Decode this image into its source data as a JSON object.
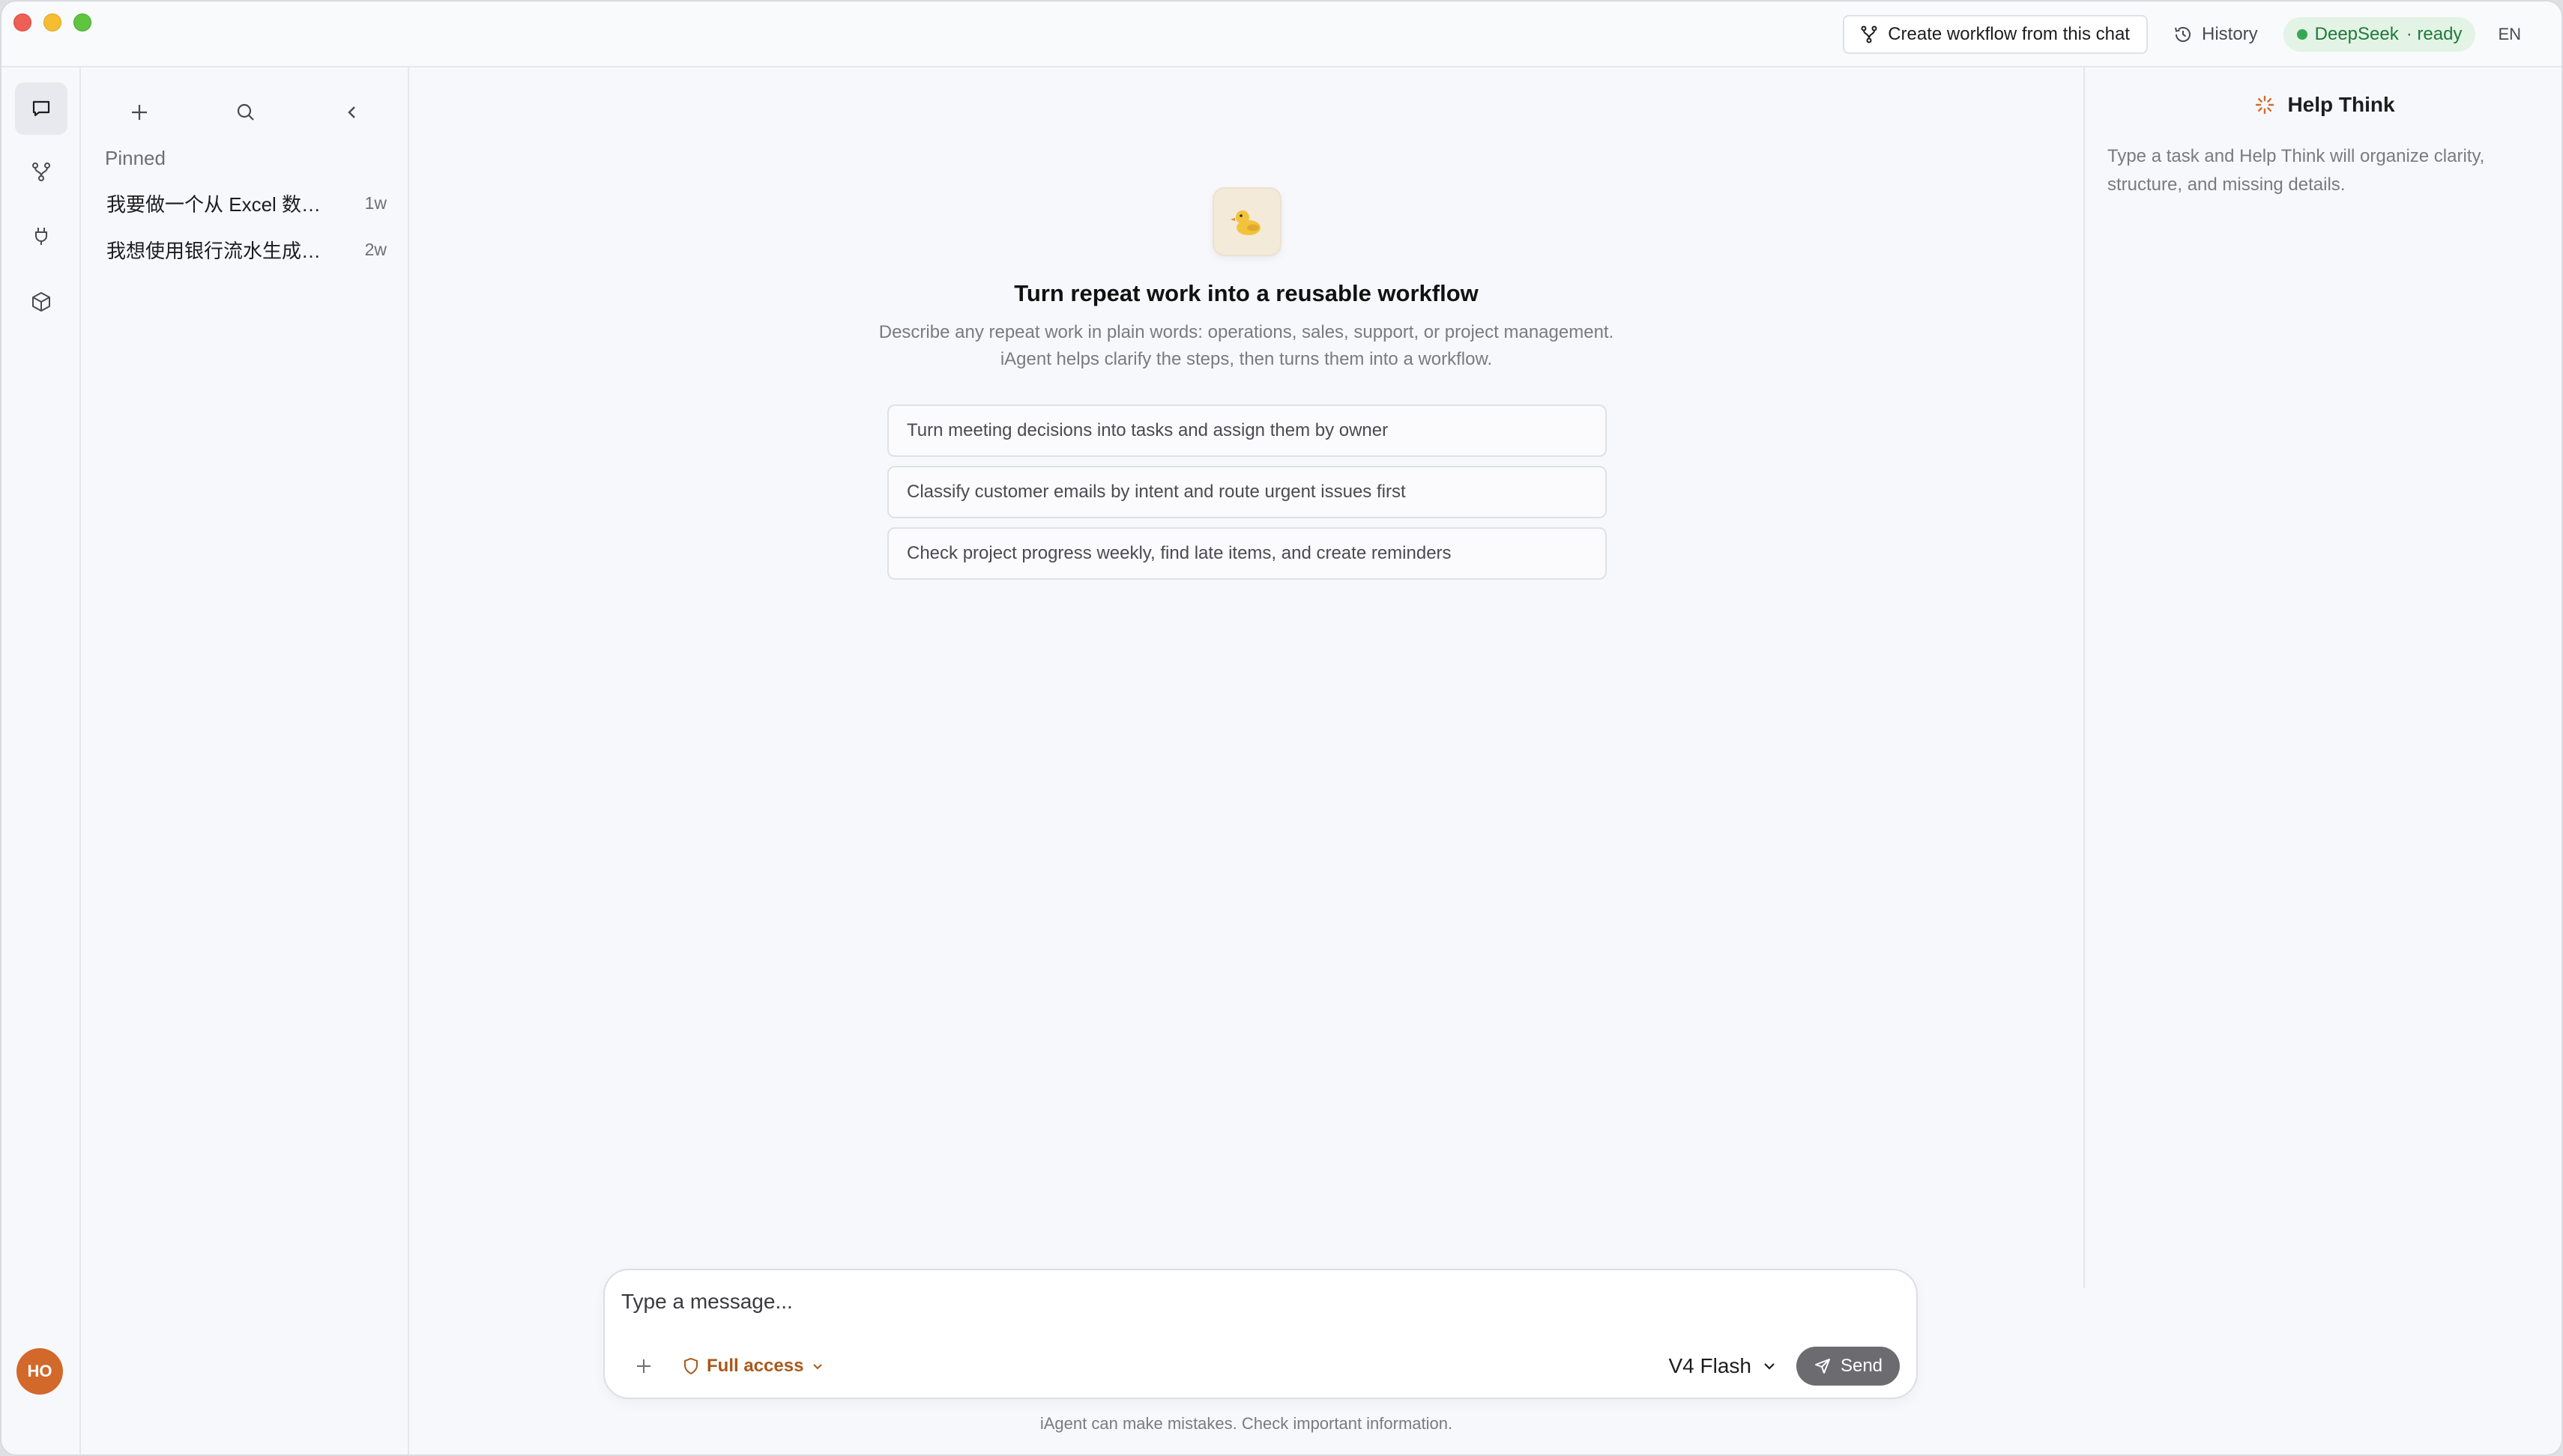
{
  "window": {
    "header": {
      "create_workflow_label": "Create workflow from this chat",
      "history_label": "History",
      "provider_name": "DeepSeek",
      "provider_status": "· ready",
      "language": "EN"
    }
  },
  "sidebar": {
    "pinned_label": "Pinned",
    "chats": [
      {
        "title": "我要做一个从 Excel 数据…",
        "time": "1w"
      },
      {
        "title": "我想使用银行流水生成报表",
        "time": "2w"
      }
    ]
  },
  "user": {
    "initials": "HO"
  },
  "main": {
    "hero_title": "Turn repeat work into a reusable workflow",
    "hero_description": "Describe any repeat work in plain words: operations, sales, support, or project management. iAgent helps clarify the steps, then turns them into a workflow.",
    "suggestions": [
      "Turn meeting decisions into tasks and assign them by owner",
      "Classify customer emails by intent and route urgent issues first",
      "Check project progress weekly, find late items, and create reminders"
    ],
    "composer": {
      "placeholder": "Type a message...",
      "access_label": "Full access",
      "model_label": "V4 Flash",
      "send_label": "Send"
    },
    "disclaimer": "iAgent can make mistakes. Check important information."
  },
  "help_panel": {
    "title": "Help Think",
    "description": "Type a task and Help Think will organize clarity, structure, and missing details."
  },
  "colors": {
    "accent_orange": "#a8591a",
    "status_green": "#1f7a3a",
    "avatar": "#d2682a",
    "send_button": "#6b6b70"
  }
}
